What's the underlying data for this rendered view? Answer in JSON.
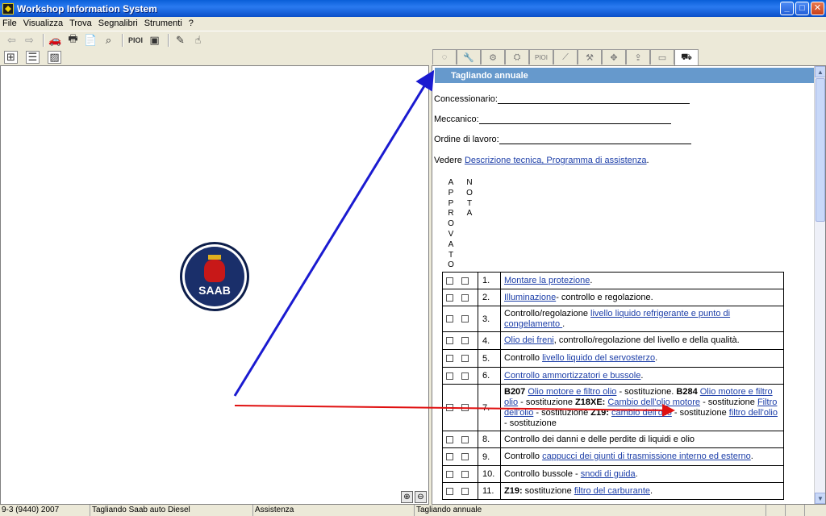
{
  "window": {
    "title": "Workshop Information System"
  },
  "menu": [
    "File",
    "Visualizza",
    "Trova",
    "Segnalibri",
    "Strumenti",
    "?"
  ],
  "toolbar": {
    "pioi_label": "PIOI"
  },
  "tabs": {
    "pioi_label": "PIOI"
  },
  "doc": {
    "header": "Tagliando annuale",
    "dealer_label": "Concessionario:",
    "mechanic_label": "Meccanico:",
    "workorder_label": "Ordine di lavoro:",
    "see_prefix": "Vedere",
    "see_link": "Descrizione tecnica, Programma di assistenza",
    "see_suffix": ".",
    "col_approved": [
      "A",
      "P",
      "P",
      "R",
      "O",
      "V",
      "A",
      "T",
      "O"
    ],
    "col_note": [
      "N",
      "O",
      "T",
      "A"
    ]
  },
  "items": [
    {
      "num": "1.",
      "link": "Montare la protezione",
      "after": "."
    },
    {
      "num": "2.",
      "link": "Illuminazione",
      "after": "- controllo e regolazione."
    },
    {
      "num": "3.",
      "before": "Controllo/regolazione ",
      "link": "livello liquido refrigerante e punto di congelamento ",
      "after": "."
    },
    {
      "num": "4.",
      "link": "Olio dei freni",
      "after": ", controllo/regolazione del livello e della qualità."
    },
    {
      "num": "5.",
      "before": "Controllo ",
      "link": "livello liquido del servosterzo",
      "after": "."
    },
    {
      "num": "6.",
      "link": "Controllo ammortizzatori e bussole",
      "after": "."
    },
    {
      "num": "7.",
      "b1": "B207",
      "l1": "Olio motore e filtro olio",
      "t1": " - sostituzione. ",
      "b2": "B284",
      "l2": "Olio motore e filtro olio",
      "t2": " - sostituzione ",
      "b3": "Z18XE:",
      "l3": "Cambio dell'olio motore",
      "t3": " - sostituzione ",
      "l4": "Filtro dell'olio",
      "t4": " - sostituzione ",
      "b5": "Z19:",
      "l5": "cambio dell'olio",
      "t5": " - sostituzione ",
      "l6": "filtro dell'olio",
      "t6": " - sostituzione"
    },
    {
      "num": "8.",
      "before": "Controllo dei danni e delle perdite di liquidi e olio"
    },
    {
      "num": "9.",
      "before": "Controllo ",
      "link": "cappucci dei giunti di trasmissione interno ed esterno",
      "after": "."
    },
    {
      "num": "10.",
      "before": "Controllo bussole - ",
      "link": "snodi di guida",
      "after": "."
    },
    {
      "num": "11.",
      "bold": "Z19:",
      "before": " sostituzione ",
      "link": "filtro del carburante",
      "after": "."
    }
  ],
  "statusbar": {
    "model": "9-3 (9440) 2007",
    "service": "Tagliando Saab auto Diesel",
    "section": "Assistenza",
    "doc": "Tagliando annuale"
  },
  "logo": {
    "text": "SAAB"
  },
  "colors": {
    "header_bg": "#6699cc",
    "link": "#1c3ea8",
    "arrow_blue": "#1a1ad0",
    "arrow_red": "#e01010"
  }
}
